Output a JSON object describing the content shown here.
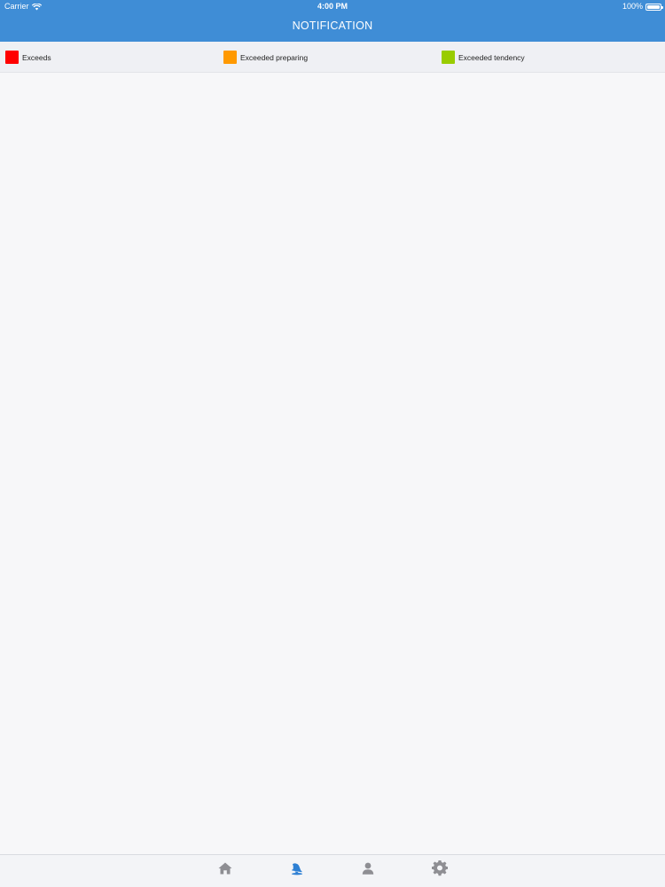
{
  "status_bar": {
    "carrier": "Carrier",
    "time": "4:00 PM",
    "battery": "100%"
  },
  "nav": {
    "title": "NOTIFICATION"
  },
  "legend": [
    {
      "label": "Exceeds",
      "color": "#ff0000"
    },
    {
      "label": "Exceeded preparing",
      "color": "#ff9900"
    },
    {
      "label": "Exceeded tendency",
      "color": "#99cc00"
    }
  ],
  "tabbar": {
    "items": [
      {
        "icon": "home-icon",
        "active": false
      },
      {
        "icon": "bell-icon",
        "active": true
      },
      {
        "icon": "user-icon",
        "active": false
      },
      {
        "icon": "gear-icon",
        "active": false
      }
    ],
    "active_color": "#2d7fd3",
    "inactive_color": "#8e8e93"
  }
}
